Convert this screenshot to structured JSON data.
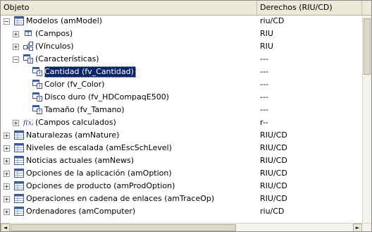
{
  "header": {
    "col_object": "Objeto",
    "col_rights": "Derechos (RIU/CD)"
  },
  "rows": [
    {
      "name": "Modelos (amModel)",
      "rights": "riu/CD",
      "expander": "−",
      "icon": "table-icon",
      "selected": false
    },
    {
      "name": "(Campos)",
      "rights": "RIU",
      "expander": "+",
      "icon": "fields-icon",
      "selected": false
    },
    {
      "name": "(Vínculos)",
      "rights": "RIU",
      "expander": "+",
      "icon": "links-icon",
      "selected": false
    },
    {
      "name": "(Características)",
      "rights": "---",
      "expander": "−",
      "icon": "features-icon",
      "selected": false
    },
    {
      "name": "Cantidad (fv_Cantidad)",
      "rights": "---",
      "expander": "",
      "icon": "feature-icon",
      "selected": true
    },
    {
      "name": "Color (fv_Color)",
      "rights": "---",
      "expander": "",
      "icon": "feature-icon",
      "selected": false
    },
    {
      "name": "Disco duro (fv_HDCompaqE500)",
      "rights": "---",
      "expander": "",
      "icon": "feature-icon",
      "selected": false
    },
    {
      "name": "Tamaño (fv_Tamano)",
      "rights": "---",
      "expander": "",
      "icon": "feature-icon",
      "selected": false
    },
    {
      "name": "(Campos calculados)",
      "rights": "r--",
      "expander": "+",
      "icon": "function-icon",
      "selected": false
    },
    {
      "name": "Naturalezas (amNature)",
      "rights": "RIU/CD",
      "expander": "+",
      "icon": "table-icon",
      "selected": false
    },
    {
      "name": "Niveles de escalada (amEscSchLevel)",
      "rights": "RIU/CD",
      "expander": "+",
      "icon": "table-icon",
      "selected": false
    },
    {
      "name": "Noticias actuales (amNews)",
      "rights": "RIU/CD",
      "expander": "+",
      "icon": "table-icon",
      "selected": false
    },
    {
      "name": "Opciones de la aplicación (amOption)",
      "rights": "RIU/CD",
      "expander": "+",
      "icon": "table-icon",
      "selected": false
    },
    {
      "name": "Opciones de producto (amProdOption)",
      "rights": "RIU/CD",
      "expander": "+",
      "icon": "table-icon",
      "selected": false
    },
    {
      "name": "Operaciones en cadena de enlaces (amTraceOp)",
      "rights": "RIU/CD",
      "expander": "+",
      "icon": "table-icon",
      "selected": false
    },
    {
      "name": "Ordenadores (amComputer)",
      "rights": "riu/CD",
      "expander": "+",
      "icon": "table-icon",
      "selected": false
    }
  ],
  "scroll": {
    "left_arrow": "◄",
    "right_arrow": "►",
    "up_arrow": "▲"
  }
}
